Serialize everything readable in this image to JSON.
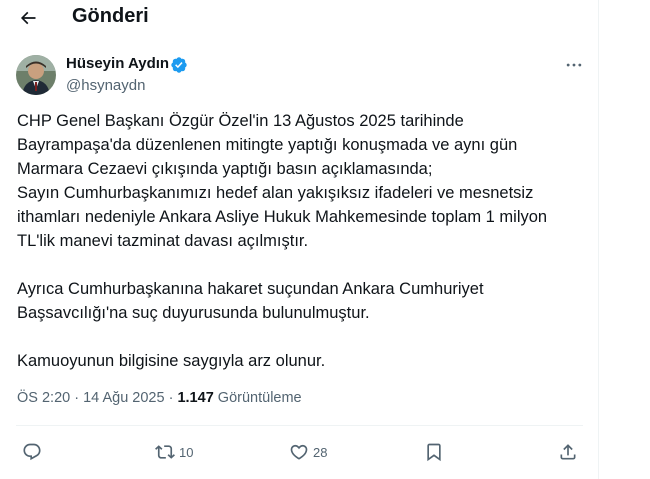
{
  "header": {
    "title": "Gönderi",
    "back_icon": "arrow-left-icon"
  },
  "author": {
    "name": "Hüseyin Aydın",
    "handle": "@hsynaydn",
    "verified": true,
    "verified_color": "#1d9bf0"
  },
  "tweet": {
    "lines": [
      "CHP Genel Başkanı Özgür Özel'in 13 Ağustos 2025 tarihinde",
      "Bayrampaşa'da düzenlenen mitingte yaptığı konuşmada ve aynı gün",
      "Marmara Cezaevi çıkışında yaptığı basın açıklamasında;",
      "Sayın Cumhurbaşkanımızı hedef alan yakışıksız ifadeleri ve mesnetsiz",
      "ithamları nedeniyle Ankara Asliye Hukuk Mahkemesinde toplam 1 milyon",
      "TL'lik manevi tazminat davası açılmıştır.",
      "Ayrıca Cumhurbaşkanına hakaret suçundan Ankara Cumhuriyet",
      "Başsavcılığı'na suç duyurusunda bulunulmuştur.",
      "Kamuoyunun bilgisine saygıyla arz olunur."
    ]
  },
  "meta": {
    "time": "ÖS 2:20",
    "separator": "·",
    "date": "14 Ağu 2025",
    "views_count": "1.147",
    "views_label": "Görüntüleme"
  },
  "actions": {
    "reply_icon": "reply-icon",
    "retweet_icon": "retweet-icon",
    "retweet_count": "10",
    "like_icon": "heart-icon",
    "like_count": "28",
    "bookmark_icon": "bookmark-icon",
    "share_icon": "share-icon"
  },
  "colors": {
    "text_primary": "#0f1419",
    "text_secondary": "#536471",
    "border": "#eff3f4"
  }
}
